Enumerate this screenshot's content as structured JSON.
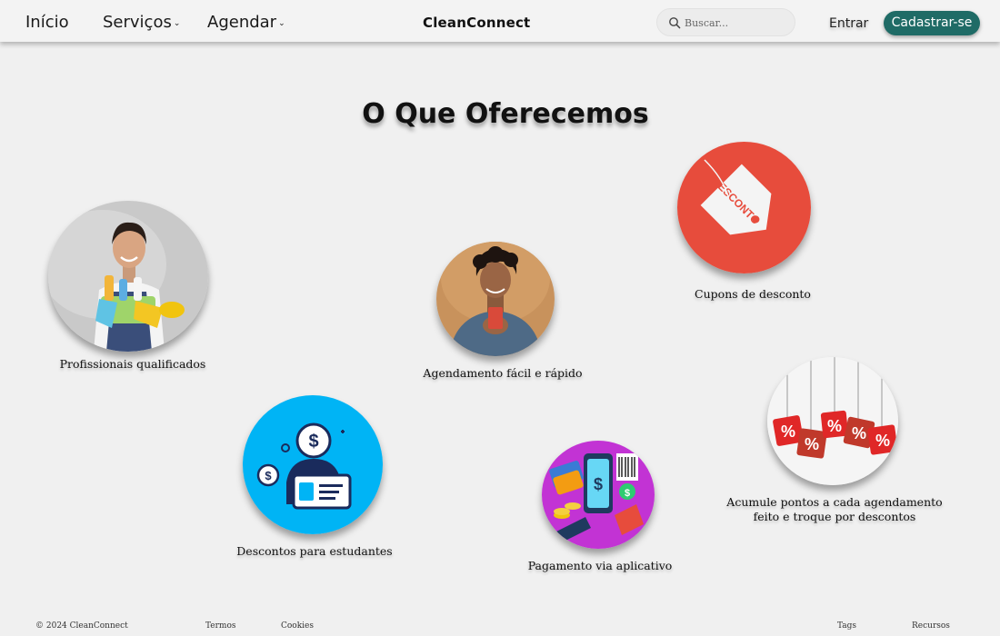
{
  "nav": {
    "links": [
      {
        "label": "Início"
      },
      {
        "label": "Serviços",
        "caret": "⌄"
      },
      {
        "label": "Agendar",
        "caret": "⌄"
      }
    ],
    "brand": "CleanConnect",
    "search_placeholder": "Buscar...",
    "login_label": "Entrar",
    "signup_label": "Cadastrar-se"
  },
  "main": {
    "title": "O Que Oferecemos",
    "features": [
      {
        "caption": "Profissionais qualificados"
      },
      {
        "caption": "Agendamento fácil e rápido"
      },
      {
        "caption": "Cupons de desconto",
        "tag_text": "DESCONTO"
      },
      {
        "caption": "Descontos para estudantes"
      },
      {
        "caption": "Pagamento via aplicativo"
      },
      {
        "caption_lines": [
          "Acumule pontos a cada agendamento",
          "feito e troque por descontos"
        ]
      }
    ]
  },
  "footer": {
    "copyright": "© 2024 CleanConnect",
    "terms": "Termos",
    "cookies": "Cookies",
    "tags": "Tags",
    "resources": "Recursos"
  },
  "colors": {
    "signup_bg": "#1f6b66",
    "discount_red": "#e74c3c",
    "student_blue": "#00b4f5",
    "payment_magenta": "#c233d4"
  }
}
